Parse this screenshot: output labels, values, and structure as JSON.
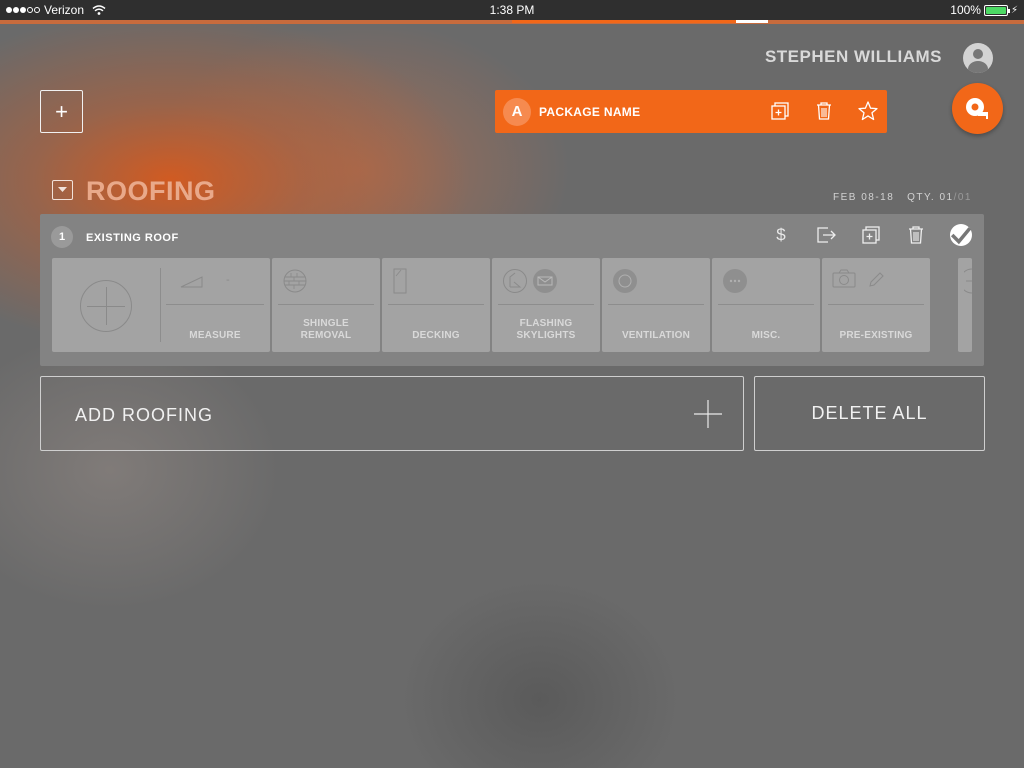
{
  "status_bar": {
    "carrier": "Verizon",
    "time": "1:38 PM",
    "battery": "100%",
    "signal_bars": 3,
    "signal_total": 5
  },
  "header": {
    "user_name": "STEPHEN WILLIAMS",
    "add_icon_text": "+"
  },
  "package": {
    "badge": "A",
    "name": "PACKAGE NAME",
    "accent_color": "#f26718"
  },
  "section": {
    "title": "ROOFING",
    "date": "FEB 08-18",
    "qty_label": "QTY.",
    "qty_current": "01",
    "qty_total": "/01"
  },
  "card": {
    "number": "1",
    "title": "EXISTING ROOF",
    "price_symbol": "$",
    "tiles": [
      {
        "label": "MEASURE",
        "icon": "roof-pitch-icon",
        "extra": "-"
      },
      {
        "label": "SHINGLE\nREMOVAL",
        "icon": "shingle-icon"
      },
      {
        "label": "DECKING",
        "icon": "decking-icon"
      },
      {
        "label": "FLASHING\nSKYLIGHTS",
        "icon": "flashing-icon"
      },
      {
        "label": "VENTILATION",
        "icon": "vent-icon"
      },
      {
        "label": "MISC.",
        "icon": "misc-icon"
      },
      {
        "label": "PRE-EXISTING",
        "icon": "camera-icon"
      }
    ]
  },
  "actions": {
    "add_label": "ADD ROOFING",
    "delete_label": "DELETE ALL"
  }
}
